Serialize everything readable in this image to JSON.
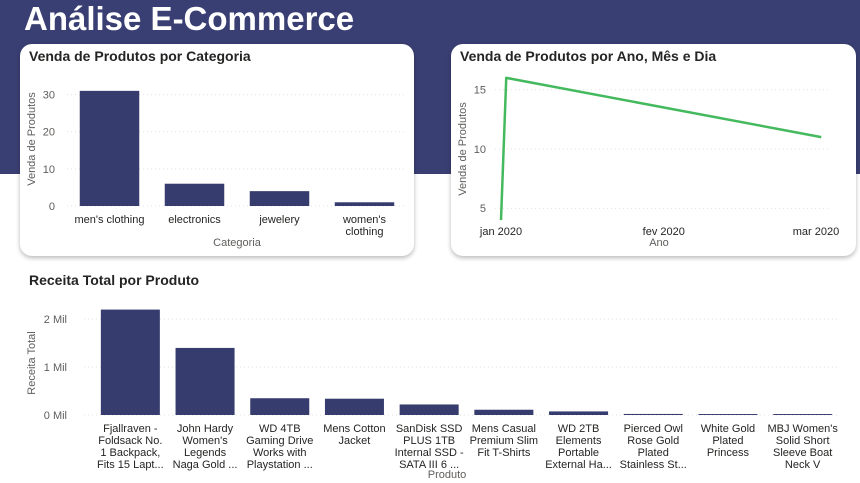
{
  "page": {
    "title": "Análise E-Commerce"
  },
  "colors": {
    "header": "#3a3f73",
    "bar": "#363c6e",
    "line": "#45b95e"
  },
  "chart_data": [
    {
      "id": "category",
      "type": "bar",
      "title": "Venda de Produtos por Categoria",
      "xlabel": "Categoria",
      "ylabel": "Venda de Produtos",
      "categories": [
        [
          "men's clothing"
        ],
        [
          "electronics"
        ],
        [
          "jewelery"
        ],
        [
          "women's",
          "clothing"
        ]
      ],
      "values": [
        31,
        6,
        4,
        1
      ],
      "ylim": [
        0,
        35
      ],
      "yticks": [
        0,
        10,
        20,
        30
      ],
      "grid": true
    },
    {
      "id": "date",
      "type": "line",
      "title": "Venda de Produtos por Ano, Mês e Dia",
      "xlabel": "Ano",
      "ylabel": "Venda de Produtos",
      "x": [
        "2020-01-01",
        "2020-01-02",
        "2020-03-02"
      ],
      "y": [
        4,
        16,
        11
      ],
      "xticks": [
        {
          "date": "2020-01-01",
          "label": "jan 2020"
        },
        {
          "date": "2020-02-01",
          "label": "fev 2020"
        },
        {
          "date": "2020-03-01",
          "label": "mar 2020"
        }
      ],
      "yticks": [
        5,
        10,
        15
      ],
      "ylim": [
        3.5,
        17
      ],
      "grid": true
    },
    {
      "id": "product",
      "type": "bar",
      "title": "Receita Total por Produto",
      "xlabel": "Produto",
      "ylabel": "Receita Total",
      "categories": [
        [
          "Fjallraven -",
          "Foldsack No.",
          "1 Backpack,",
          "Fits 15 Lapt..."
        ],
        [
          "John Hardy",
          "Women's",
          "Legends",
          "Naga Gold ..."
        ],
        [
          "WD 4TB",
          "Gaming Drive",
          "Works with",
          "Playstation ..."
        ],
        [
          "Mens Cotton",
          "Jacket"
        ],
        [
          "SanDisk SSD",
          "PLUS 1TB",
          "Internal SSD -",
          "SATA III 6 ..."
        ],
        [
          "Mens Casual",
          "Premium Slim",
          "Fit T-Shirts"
        ],
        [
          "WD 2TB",
          "Elements",
          "Portable",
          "External Ha..."
        ],
        [
          "Pierced Owl",
          "Rose Gold",
          "Plated",
          "Stainless St..."
        ],
        [
          "White Gold",
          "Plated",
          "Princess"
        ],
        [
          "MBJ Women's",
          "Solid Short",
          "Sleeve Boat",
          "Neck V"
        ]
      ],
      "values": [
        2200,
        1400,
        350,
        340,
        220,
        110,
        75,
        22,
        20,
        20
      ],
      "ylim": [
        0,
        2400
      ],
      "yticks": [
        {
          "value": 0,
          "label": "0 Mil"
        },
        {
          "value": 1000,
          "label": "1 Mil"
        },
        {
          "value": 2000,
          "label": "2 Mil"
        }
      ],
      "grid": true
    }
  ]
}
